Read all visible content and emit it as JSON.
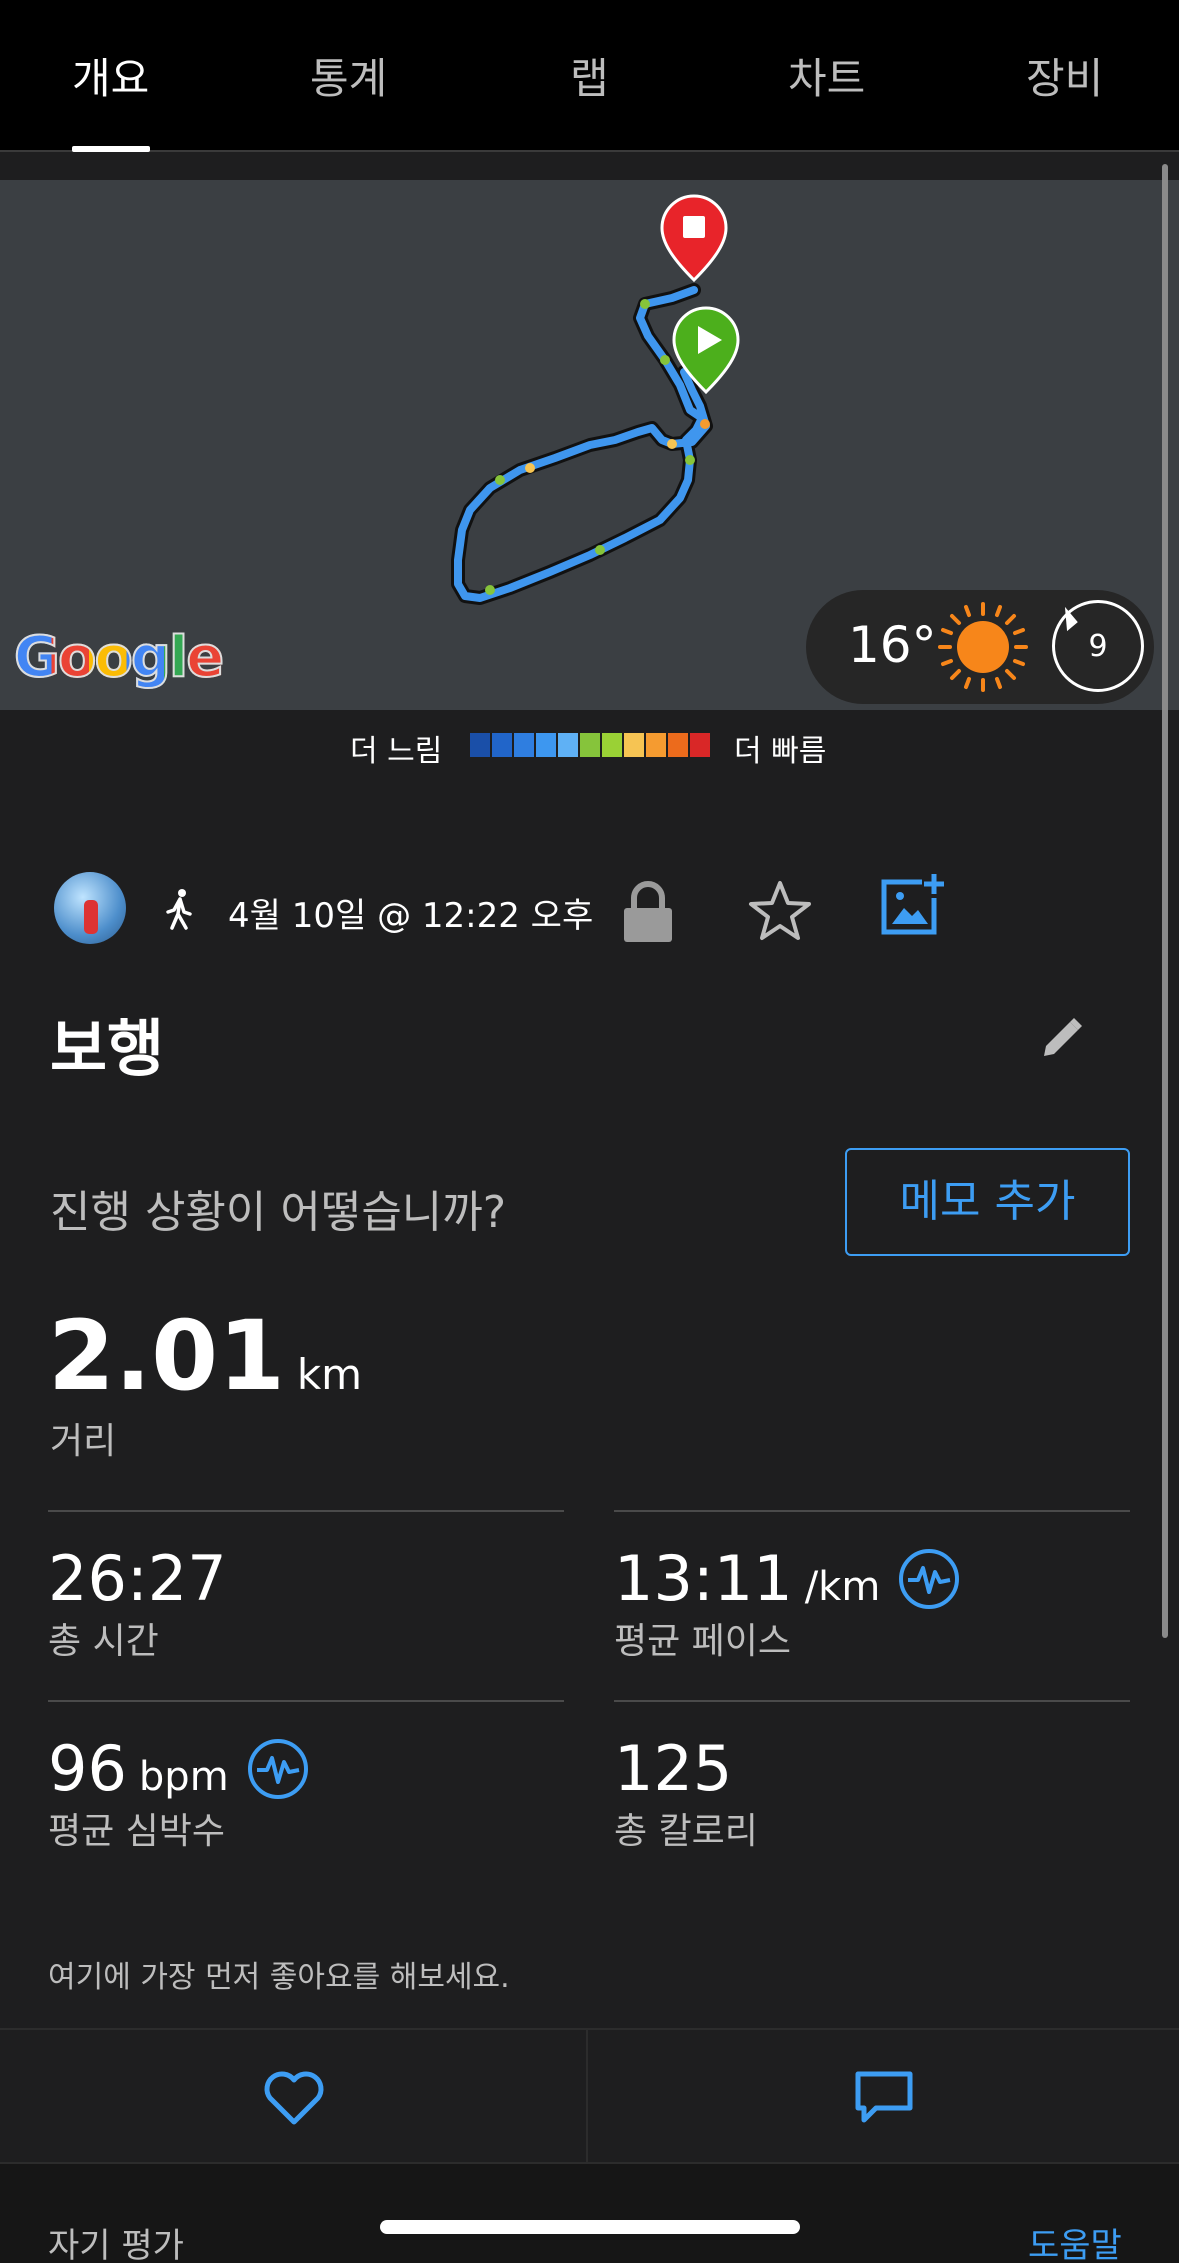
{
  "tabs": [
    {
      "label": "개요",
      "active": true
    },
    {
      "label": "통계"
    },
    {
      "label": "랩"
    },
    {
      "label": "차트"
    },
    {
      "label": "장비"
    }
  ],
  "map": {
    "logo": "Google",
    "start_icon": "play-marker-icon",
    "end_icon": "stop-marker-icon",
    "weather": {
      "temperature": "16°",
      "condition_icon": "sun-icon",
      "wind_speed": "9"
    }
  },
  "pace_legend": {
    "slow_label": "더 느림",
    "fast_label": "더 빠름",
    "colors": [
      "#1a4fa8",
      "#2165c9",
      "#2f7ee0",
      "#3d97f0",
      "#5fb1f5",
      "#86c43b",
      "#9ad135",
      "#f6c453",
      "#f59b30",
      "#ec6b1c",
      "#d92727"
    ]
  },
  "activity": {
    "type_icon": "walking-icon",
    "datetime": "4월 10일 @ 12:22 오후",
    "title": "보행",
    "prompt": "진행 상황이 어떻습니까?",
    "memo_button": "메모 추가"
  },
  "distance": {
    "value": "2.01",
    "unit": "km",
    "label": "거리"
  },
  "stats": [
    {
      "value": "26:27",
      "unit": "",
      "label": "총 시간"
    },
    {
      "value": "13:11",
      "unit": "/km",
      "label": "평균 페이스"
    },
    {
      "value": "96",
      "unit": "bpm",
      "label": "평균 심박수"
    },
    {
      "value": "125",
      "unit": "",
      "label": "총 칼로리"
    }
  ],
  "social": {
    "like_prompt": "여기에 가장 먼저 좋아요를 해보세요."
  },
  "bottom": {
    "self_eval": "자기 평가",
    "help": "도움말"
  },
  "colors": {
    "accent": "#3d9df3",
    "background": "#1e1e1f",
    "tabbar": "#000000",
    "map": "#3b3f43"
  }
}
